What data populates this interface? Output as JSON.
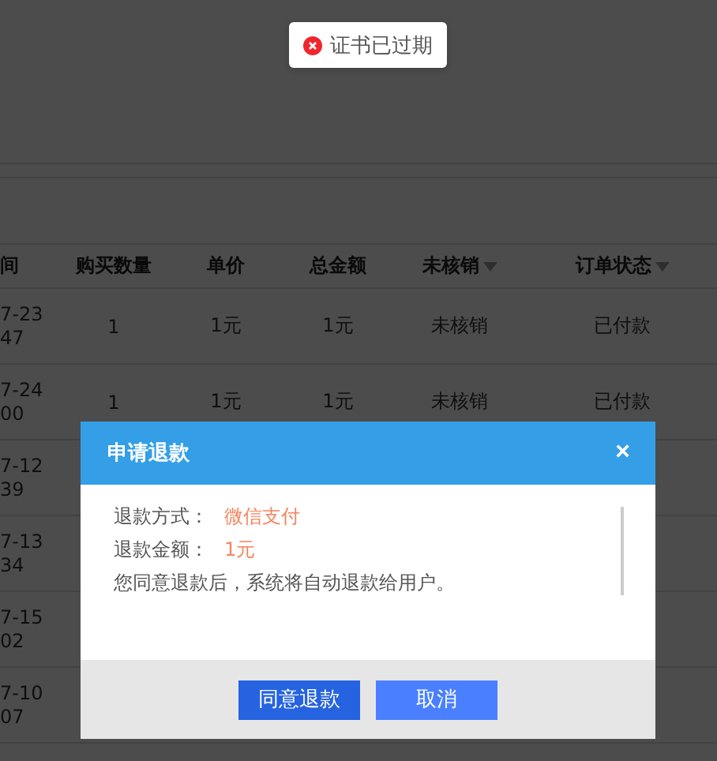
{
  "toast": {
    "message": "证书已过期"
  },
  "table": {
    "columns": [
      {
        "label": "间",
        "dropdown": false
      },
      {
        "label": "购买数量",
        "dropdown": false
      },
      {
        "label": "单价",
        "dropdown": false
      },
      {
        "label": "总金额",
        "dropdown": false
      },
      {
        "label": "未核销",
        "dropdown": true
      },
      {
        "label": "订单状态",
        "dropdown": true
      }
    ],
    "rows": [
      {
        "date": "7-23",
        "time": "47",
        "quantity": "1",
        "unit_price": "1元",
        "total": "1元",
        "verification": "未核销",
        "order_status": "已付款"
      },
      {
        "date": "7-24",
        "time": "00",
        "quantity": "1",
        "unit_price": "1元",
        "total": "1元",
        "verification": "未核销",
        "order_status": "已付款"
      },
      {
        "date": "7-12",
        "time": "39"
      },
      {
        "date": "7-13",
        "time": "34"
      },
      {
        "date": "7-15",
        "time": "02"
      },
      {
        "date": "7-10",
        "time": "07"
      }
    ]
  },
  "dialog": {
    "title": "申请退款",
    "close": "×",
    "fields": [
      {
        "label": "退款方式：",
        "value": "微信支付"
      },
      {
        "label": "退款金额：",
        "value": "1元"
      }
    ],
    "note": "您同意退款后，系统将自动退款给用户。",
    "buttons": [
      {
        "label": "同意退款",
        "kind": "primary"
      },
      {
        "label": "取消",
        "kind": "secondary"
      }
    ]
  }
}
